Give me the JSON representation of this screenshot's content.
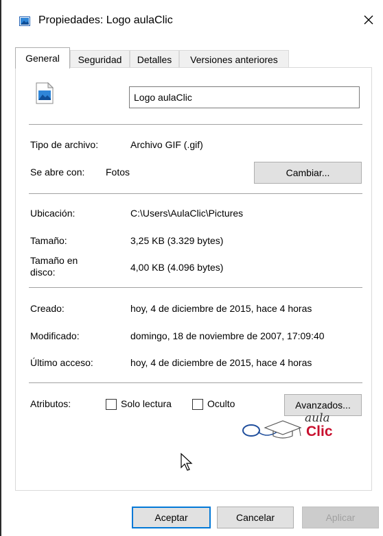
{
  "window": {
    "title": "Propiedades: Logo aulaClic",
    "close_glyph": "✕"
  },
  "tabs": [
    {
      "label": "General",
      "active": true
    },
    {
      "label": "Seguridad",
      "active": false
    },
    {
      "label": "Detalles",
      "active": false
    },
    {
      "label": "Versiones anteriores",
      "active": false
    }
  ],
  "general": {
    "file_name": "Logo aulaClic",
    "file_type_label": "Tipo de archivo:",
    "file_type_value": "Archivo GIF (.gif)",
    "opens_with_label": "Se abre con:",
    "opens_with_value": "Fotos",
    "change_button": "Cambiar...",
    "location_label": "Ubicación:",
    "location_value": "C:\\Users\\AulaClic\\Pictures",
    "size_label": "Tamaño:",
    "size_value": "3,25 KB (3.329 bytes)",
    "disk_size_label_line1": "Tamaño en",
    "disk_size_label_line2": "disco:",
    "disk_size_value": "4,00 KB (4.096 bytes)",
    "created_label": "Creado:",
    "created_value": "hoy, 4 de diciembre de 2015, hace 4 horas",
    "modified_label": "Modificado:",
    "modified_value": "domingo, 18 de noviembre de 2007, 17:09:40",
    "accessed_label": "Último acceso:",
    "accessed_value": "hoy, 4 de diciembre de 2015, hace 4 horas",
    "attributes_label": "Atributos:",
    "readonly_label": "Solo lectura",
    "readonly_checked": false,
    "hidden_label": "Oculto",
    "hidden_checked": false,
    "advanced_button": "Avanzados..."
  },
  "logo": {
    "line1": "aula",
    "line2": "Clic",
    "accent_color": "#c8102e",
    "mark_color": "#1f4e9c"
  },
  "footer": {
    "ok_button": "Aceptar",
    "cancel_button": "Cancelar",
    "apply_button": "Aplicar"
  },
  "colors": {
    "accent": "#0078d7",
    "button_bg": "#e1e1e1",
    "disabled_text": "#a0a0a0"
  }
}
